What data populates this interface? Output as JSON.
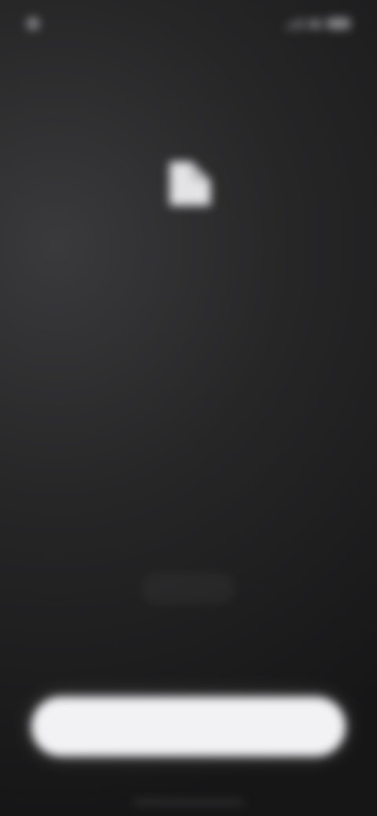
{
  "status_bar": {
    "time": "",
    "icons": [
      "notification-dot-icon",
      "signal-icon",
      "wifi-icon",
      "battery-icon"
    ]
  },
  "header": {
    "title": ""
  },
  "hero": {
    "icon": "document-icon"
  },
  "content": {
    "subtitle": "",
    "headline": "",
    "description": ""
  },
  "secondary_action": {
    "label": ""
  },
  "primary_action": {
    "label": ""
  },
  "colors": {
    "background": "#1c1c1e",
    "primary_button_bg": "#f2f2f4",
    "text_primary": "#e6e6e8",
    "text_secondary": "#a3a3a6"
  }
}
